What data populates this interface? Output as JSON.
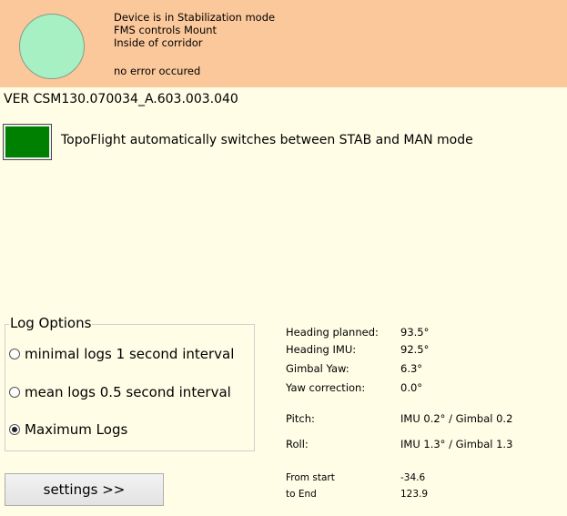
{
  "status": {
    "line1": "Device is in Stabilization mode",
    "line2": "FMS controls Mount",
    "line3": "Inside of corridor",
    "error": "no error occured",
    "indicator_color": "#A7F0C3",
    "panel_color": "#FBC89B"
  },
  "version": "VER CSM130.070034_A.603.003.040",
  "mode": {
    "button_color": "#008000",
    "text": "TopoFlight automatically switches between STAB and MAN mode"
  },
  "log_options": {
    "title": "Log Options",
    "options": [
      {
        "label": "minimal logs 1 second interval",
        "selected": false
      },
      {
        "label": "mean logs 0.5 second interval",
        "selected": false
      },
      {
        "label": "Maximum Logs",
        "selected": true
      }
    ]
  },
  "settings_button": "settings >>",
  "telemetry": {
    "heading_planned_label": "Heading planned:",
    "heading_planned_value": "93.5°",
    "heading_imu_label": "Heading IMU:",
    "heading_imu_value": "92.5°",
    "gimbal_yaw_label": "Gimbal Yaw:",
    "gimbal_yaw_value": "6.3°",
    "yaw_correction_label": "Yaw correction:",
    "yaw_correction_value": "0.0°",
    "pitch_label": "Pitch:",
    "pitch_value": "IMU 0.2° / Gimbal 0.2",
    "roll_label": "Roll:",
    "roll_value": "IMU 1.3° / Gimbal 1.3",
    "from_start_label": "From start",
    "from_start_value": "-34.6",
    "to_end_label": "to End",
    "to_end_value": "123.9"
  }
}
